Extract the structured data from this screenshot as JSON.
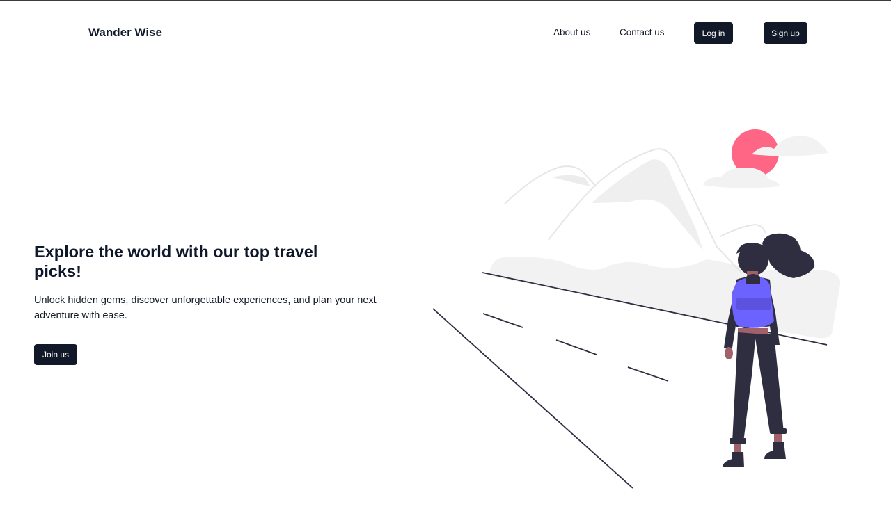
{
  "header": {
    "brand": "Wander Wise",
    "nav": {
      "about": "About us",
      "contact": "Contact us"
    },
    "login_label": "Log in",
    "signup_label": "Sign up"
  },
  "hero": {
    "title": "Explore the world with our top travel picks!",
    "subtitle": "Unlock hidden gems, discover unforgettable experiences, and plan your next adventure with ease.",
    "cta_label": "Join us"
  },
  "colors": {
    "primary_button": "#111827",
    "sun": "#ff6584",
    "backpack": "#6c63ff",
    "figure": "#2f2e41",
    "skin": "#a0616a",
    "mist": "#f2f2f2"
  },
  "illustration": {
    "icon": "traveler-with-backpack-illustration"
  }
}
